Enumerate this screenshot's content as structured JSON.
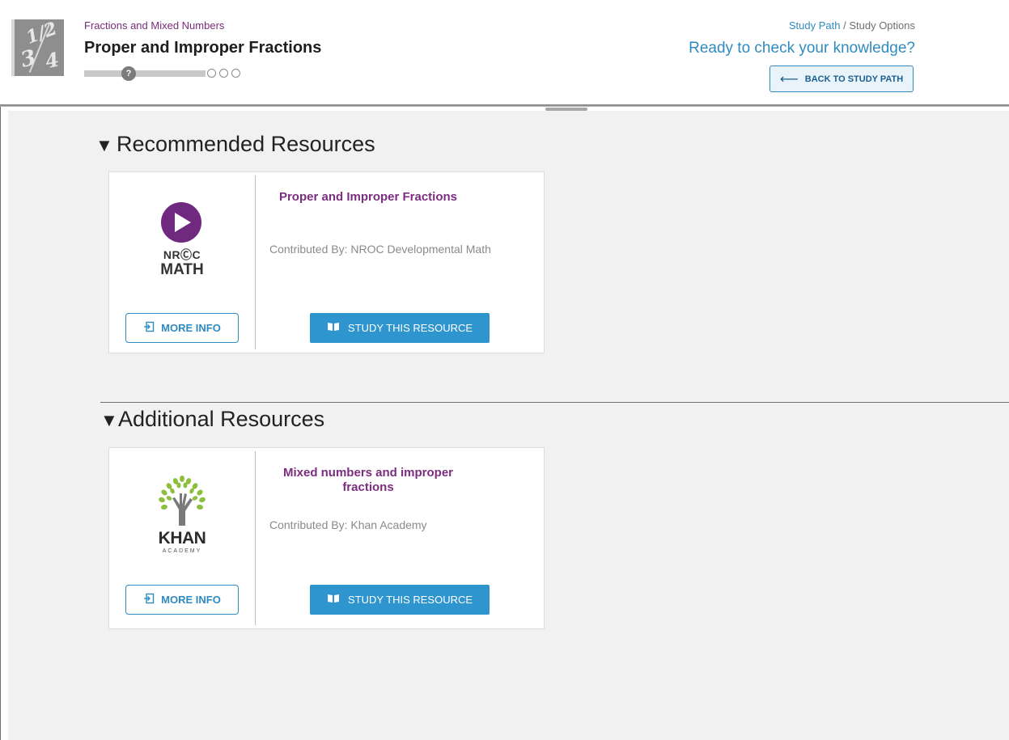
{
  "header": {
    "topic": "Fractions and Mixed Numbers",
    "title": "Proper and Improper Fractions",
    "progress_marker": "?",
    "progress_fraction": 0.35,
    "breadcrumb": {
      "link": "Study Path",
      "separator": "/",
      "current": "Study Options"
    },
    "prompt": "Ready to check your knowledge?",
    "back_button": "BACK TO STUDY PATH"
  },
  "sections": [
    {
      "heading": "Recommended Resources",
      "resource": {
        "title": "Proper and Improper Fractions",
        "contributor": "Contributed By: NROC Developmental Math",
        "logo_line1": "NRⒸC",
        "logo_line2": "MATH",
        "more_info": "MORE INFO",
        "study": "STUDY THIS RESOURCE"
      }
    },
    {
      "heading": "Additional Resources",
      "resource": {
        "title": "Mixed numbers and improper fractions",
        "contributor": "Contributed By: Khan Academy",
        "logo_line1": "KHAN",
        "logo_line2": "ACADEMY",
        "more_info": "MORE INFO",
        "study": "STUDY THIS RESOURCE"
      }
    }
  ],
  "icons": {
    "expanded": "triangle-down-icon",
    "back": "arrow-left-icon",
    "more_info": "login-icon",
    "study": "book-icon"
  },
  "colors": {
    "accent_blue": "#2f8bbf",
    "button_blue": "#2f95cf",
    "title_purple": "#7b2d80",
    "background": "#f1f1f1"
  }
}
